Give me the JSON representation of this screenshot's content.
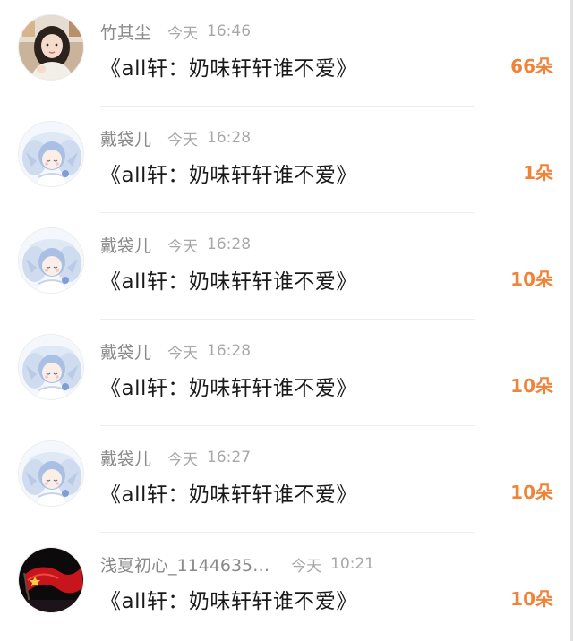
{
  "feed": {
    "items": [
      {
        "username": "竹其尘",
        "day": "今天",
        "time": "16:46",
        "title": "《all轩：奶味轩轩谁不爱》",
        "count": "66朵",
        "avatar": "girl-photo-avatar"
      },
      {
        "username": "戴袋儿",
        "day": "今天",
        "time": "16:28",
        "title": "《all轩：奶味轩轩谁不爱》",
        "count": "1朵",
        "avatar": "anime-angel-avatar"
      },
      {
        "username": "戴袋儿",
        "day": "今天",
        "time": "16:28",
        "title": "《all轩：奶味轩轩谁不爱》",
        "count": "10朵",
        "avatar": "anime-angel-avatar"
      },
      {
        "username": "戴袋儿",
        "day": "今天",
        "time": "16:28",
        "title": "《all轩：奶味轩轩谁不爱》",
        "count": "10朵",
        "avatar": "anime-angel-avatar"
      },
      {
        "username": "戴袋儿",
        "day": "今天",
        "time": "16:27",
        "title": "《all轩：奶味轩轩谁不爱》",
        "count": "10朵",
        "avatar": "anime-angel-avatar"
      },
      {
        "username": "浅夏初心_1144635…",
        "day": "今天",
        "time": "10:21",
        "title": "《all轩：奶味轩轩谁不爱》",
        "count": "10朵",
        "avatar": "red-flag-avatar"
      }
    ]
  },
  "colors": {
    "username": "#8a8a8a",
    "timestamp": "#a8a8a8",
    "title": "#1a1a1a",
    "flower_count": "#f0833a",
    "divider": "#eeeeee"
  }
}
